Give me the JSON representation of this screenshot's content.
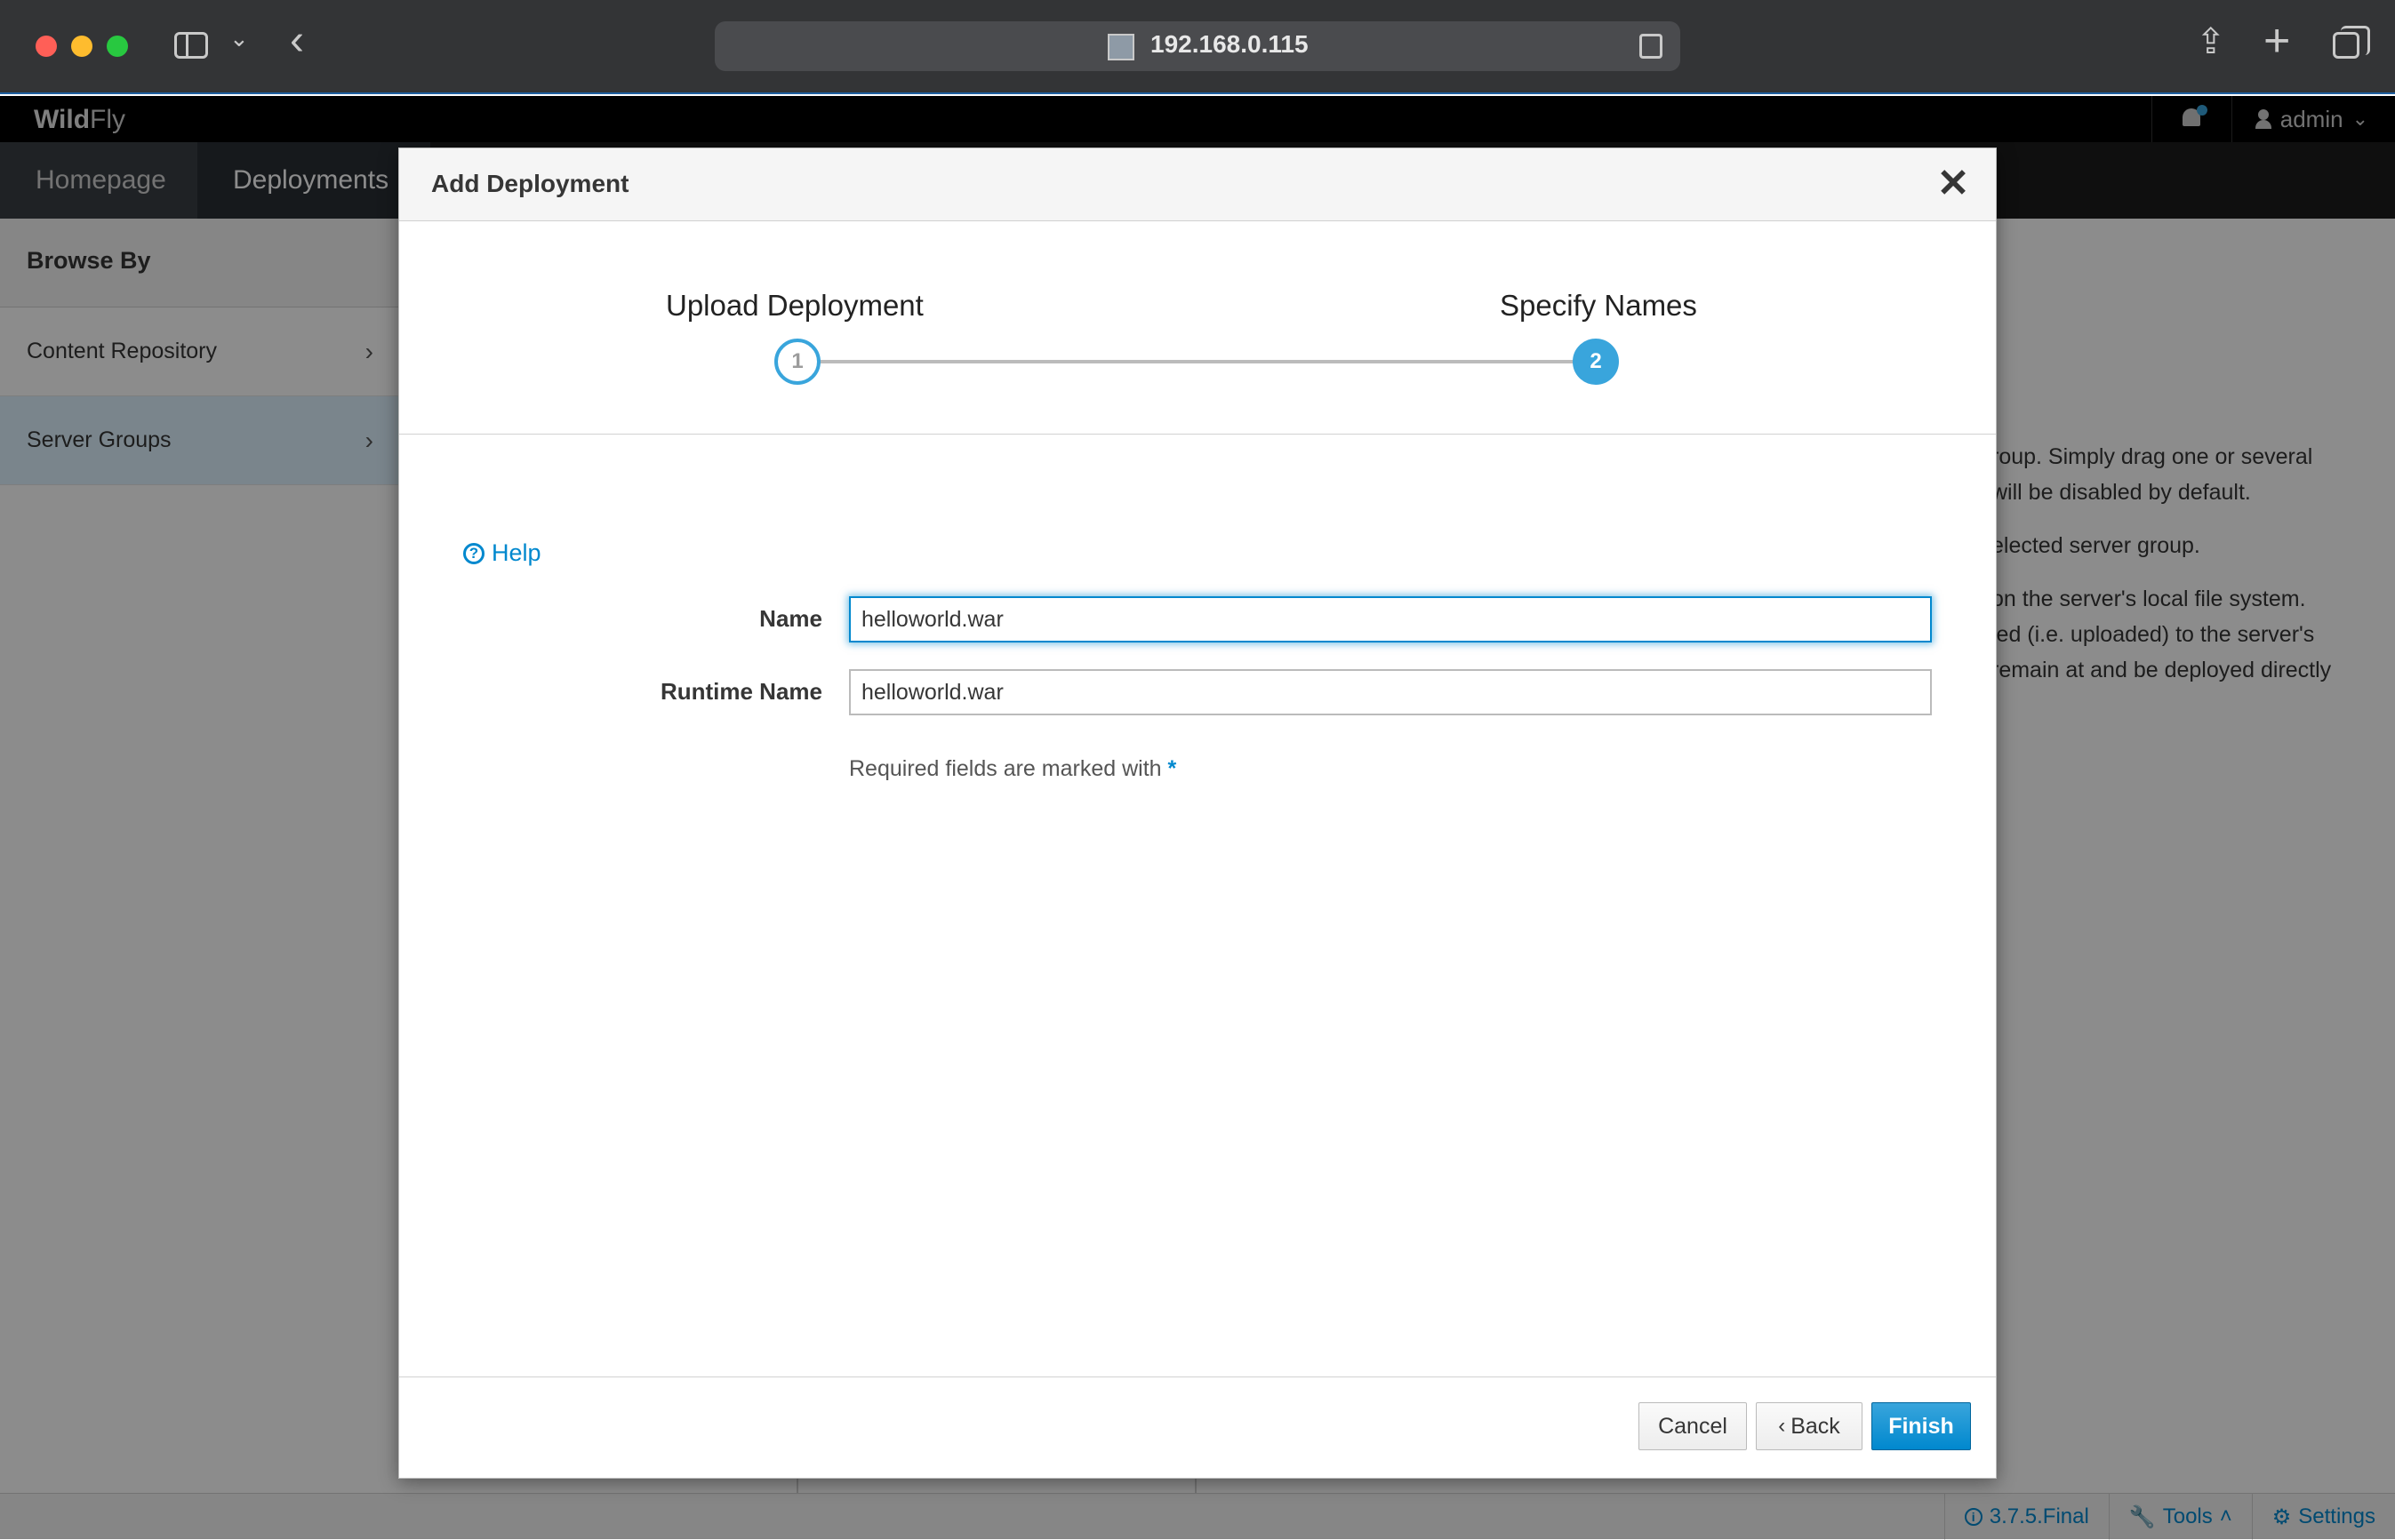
{
  "browser": {
    "url": "192.168.0.115"
  },
  "app": {
    "brand_bold": "Wild",
    "brand_light": "Fly",
    "user": "admin"
  },
  "nav": {
    "items": [
      {
        "label": "Homepage"
      },
      {
        "label": "Deployments"
      }
    ]
  },
  "left_panel": {
    "heading": "Browse By",
    "items": [
      {
        "label": "Content Repository"
      },
      {
        "label": "Server Groups"
      }
    ]
  },
  "background_text": {
    "lines": [
      "roup. Simply drag one or several",
      " will be disabled by default.",
      "elected server group.",
      " on the server's local file system.",
      "ied (i.e. uploaded) to the server's",
      " remain at and be deployed directly"
    ]
  },
  "footer": {
    "version": "3.7.5.Final",
    "tools": "Tools",
    "settings": "Settings"
  },
  "modal": {
    "title": "Add Deployment",
    "steps": [
      {
        "label": "Upload Deployment",
        "number": "1"
      },
      {
        "label": "Specify Names",
        "number": "2"
      }
    ],
    "help": "Help",
    "fields": {
      "name_label": "Name",
      "name_value": "helloworld.war",
      "runtime_label": "Runtime Name",
      "runtime_value": "helloworld.war"
    },
    "required_note": "Required fields are marked with",
    "required_star": "*",
    "buttons": {
      "cancel": "Cancel",
      "back": "Back",
      "finish": "Finish"
    }
  },
  "colors": {
    "accent": "#0088ce",
    "step_active": "#39a5dc",
    "chrome_bg": "#333436",
    "header_bg": "#000000"
  }
}
